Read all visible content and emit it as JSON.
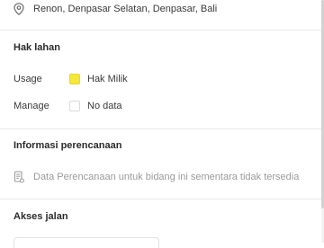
{
  "location": {
    "icon": "map-pin-icon",
    "address": "Renon, Denpasar Selatan, Denpasar, Bali"
  },
  "land_rights": {
    "title": "Hak lahan",
    "usage": {
      "label": "Usage",
      "value": "Hak Milik",
      "color": "#f5e63a"
    },
    "manage": {
      "label": "Manage",
      "value": "No data",
      "color": "#ffffff"
    }
  },
  "planning": {
    "title": "Informasi perencanaan",
    "icon": "document-icon",
    "message": "Data Perencanaan untuk bidang ini sementara tidak tersedia"
  },
  "road_access": {
    "title": "Akses jalan"
  }
}
